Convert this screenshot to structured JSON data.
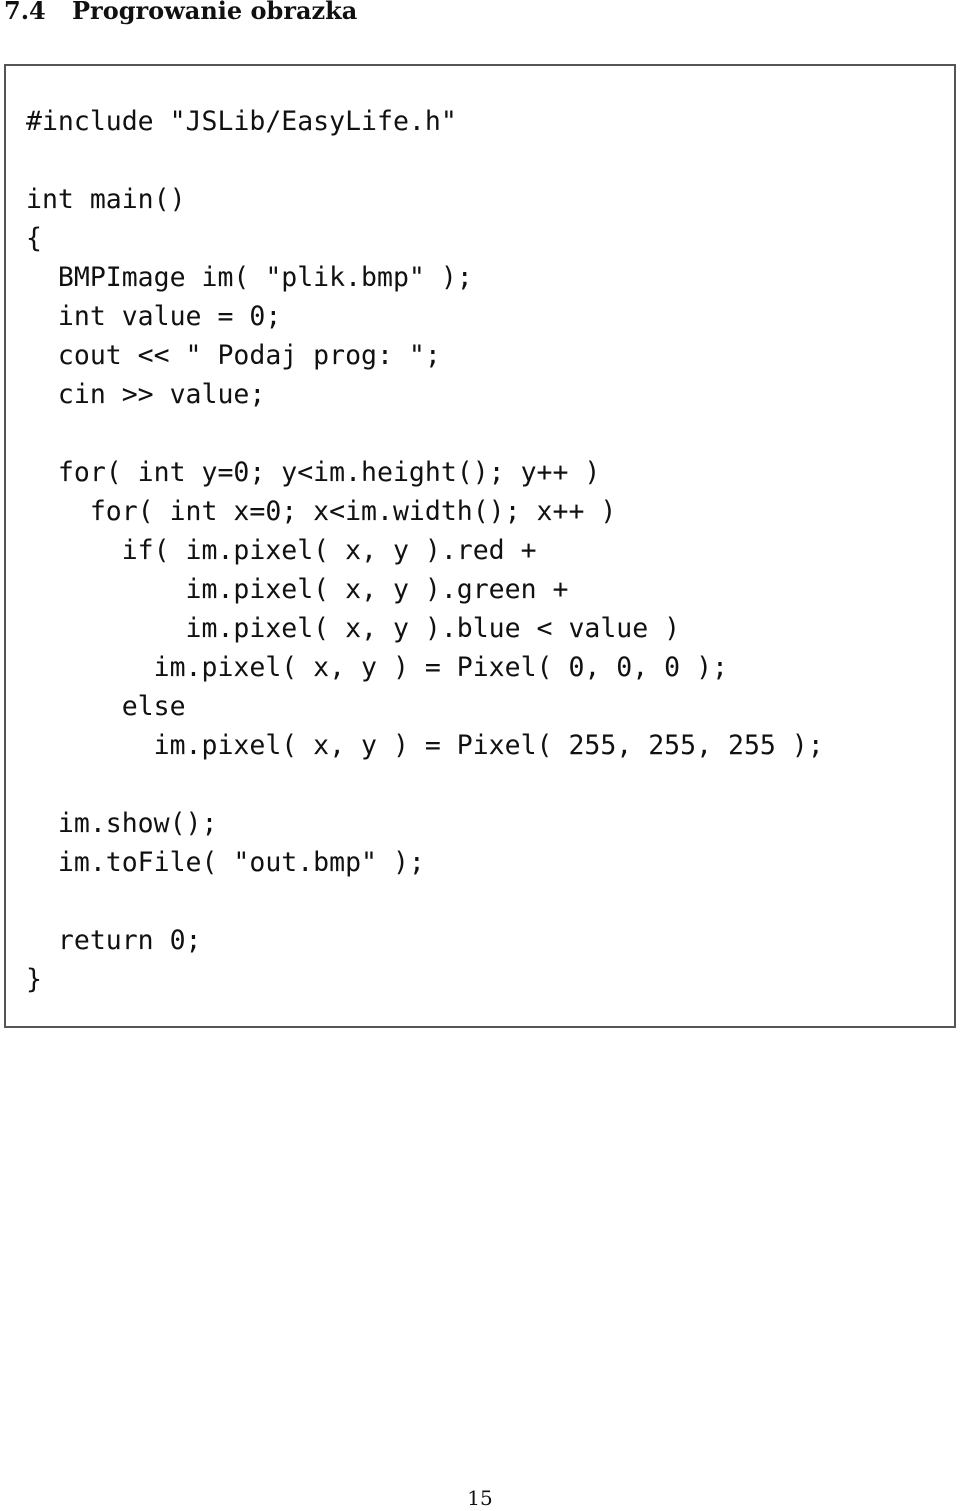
{
  "section": {
    "number": "7.4",
    "title": "Progrowanie obrazka"
  },
  "code": {
    "lines": [
      "#include \"JSLib/EasyLife.h\"",
      "",
      "int main()",
      "{",
      "  BMPImage im( \"plik.bmp\" );",
      "  int value = 0;",
      "  cout << \" Podaj prog: \";",
      "  cin >> value;",
      "",
      "  for( int y=0; y<im.height(); y++ )",
      "    for( int x=0; x<im.width(); x++ )",
      "      if( im.pixel( x, y ).red +",
      "          im.pixel( x, y ).green +",
      "          im.pixel( x, y ).blue < value )",
      "        im.pixel( x, y ) = Pixel( 0, 0, 0 );",
      "      else",
      "        im.pixel( x, y ) = Pixel( 255, 255, 255 );",
      "",
      "  im.show();",
      "  im.toFile( \"out.bmp\" );",
      "",
      "  return 0;",
      "}"
    ]
  },
  "footer": {
    "page_number": "15"
  }
}
